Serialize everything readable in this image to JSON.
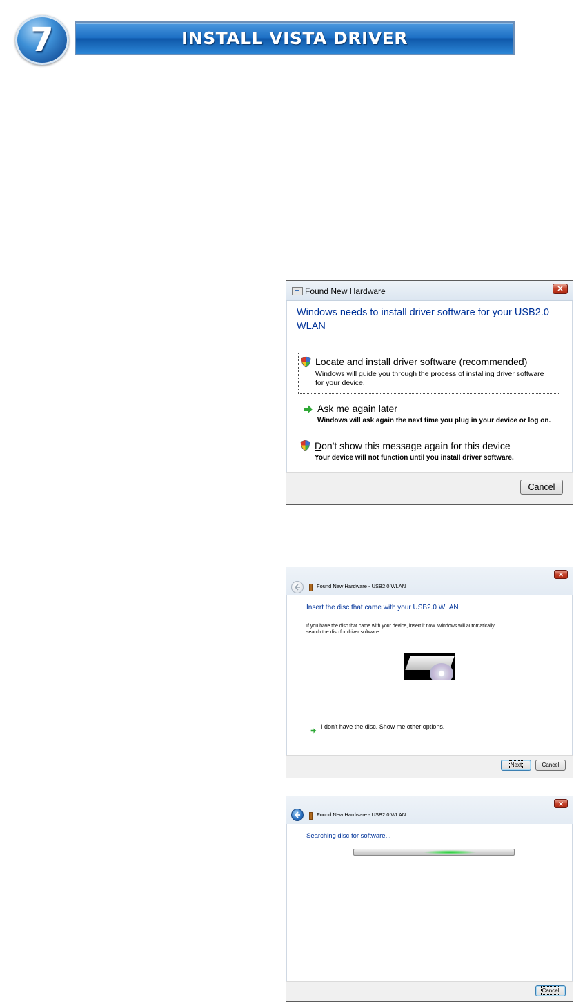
{
  "header": {
    "step_number": "7",
    "banner_text": "INSTALL VISTA DRIVER"
  },
  "dialog1": {
    "title": "Found New Hardware",
    "heading_line1": "Windows needs to install driver software for your USB2.0",
    "heading_line2": "WLAN",
    "options": [
      {
        "icon": "shield-icon",
        "title_rest": "Locate and install driver software (recommended)",
        "desc_line1": "Windows will guide you through the process of installing driver software",
        "desc_line2": "for your device."
      },
      {
        "icon": "green-arrow-icon",
        "title_underline": "A",
        "title_rest": "sk me again later",
        "desc_line1": "Windows will ask again the next time you plug in your device or log on."
      },
      {
        "icon": "shield-icon",
        "title_underline": "D",
        "title_rest": "on't show this message again for this device",
        "desc_line1": "Your device will not function until you install driver software."
      }
    ],
    "cancel_label": "Cancel"
  },
  "dialog2": {
    "title": "Found New Hardware - USB2.0 WLAN",
    "heading": "Insert the disc that came with your USB2.0 WLAN",
    "body_line1": "If you have the disc that came with your device, insert it now.  Windows will automatically",
    "body_line2": "search the disc for driver software.",
    "link_text": "I don't have the disc.  Show me other options.",
    "next_label": "Next",
    "cancel_label": "Cancel"
  },
  "dialog3": {
    "title": "Found New Hardware - USB2.0 WLAN",
    "heading": "Searching disc for software...",
    "cancel_label": "Cancel"
  },
  "colors": {
    "heading": "#003399",
    "banner": "#1c6fc4",
    "close_button": "#c4432c",
    "progress_glow": "#22c23a"
  }
}
